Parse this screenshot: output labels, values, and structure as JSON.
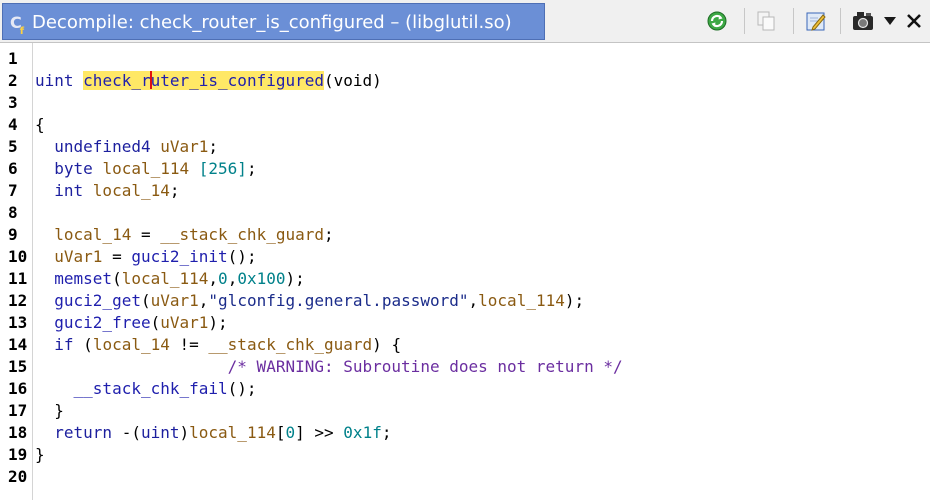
{
  "window": {
    "title": "Decompile: check_router_is_configured –  (libglutil.so)",
    "accent": "#6b8fd6"
  },
  "toolbar": {
    "icons": [
      "refresh-icon",
      "copy-icon",
      "edit-icon",
      "snapshot-icon",
      "menu-down-icon",
      "close-icon"
    ]
  },
  "code": {
    "line_numbers": [
      "1",
      "2",
      "3",
      "4",
      "5",
      "6",
      "7",
      "8",
      "9",
      "10",
      "11",
      "12",
      "13",
      "14",
      "15",
      "16",
      "17",
      "18",
      "19",
      "20"
    ],
    "func_name_a": "check_r",
    "func_name_b": "uter_is_configured",
    "lines": {
      "l2_type": "uint ",
      "l2_rest": "(void)",
      "l4": "{",
      "l5_type": "undefined4 ",
      "l5_var": "uVar1",
      "l5_end": ";",
      "l6_type": "byte ",
      "l6_var": "local_114 ",
      "l6_num": "[256]",
      "l6_end": ";",
      "l7_type": "int ",
      "l7_var": "local_14",
      "l7_end": ";",
      "l9_var": "local_14",
      "l9_op": " = ",
      "l9_fn": "__stack_chk_guard",
      "l9_end": ";",
      "l10_var": "uVar1",
      "l10_op": " = ",
      "l10_fn": "guci2_init",
      "l10_end": "();",
      "l11_fn": "memset",
      "l11_open": "(",
      "l11_var": "local_114",
      "l11_c1": ",",
      "l11_n1": "0",
      "l11_c2": ",",
      "l11_n2": "0x100",
      "l11_end": ");",
      "l12_fn": "guci2_get",
      "l12_open": "(",
      "l12_var1": "uVar1",
      "l12_c1": ",",
      "l12_str": "\"glconfig.general.password\"",
      "l12_c2": ",",
      "l12_var2": "local_114",
      "l12_end": ");",
      "l13_fn": "guci2_free",
      "l13_open": "(",
      "l13_var": "uVar1",
      "l13_end": ");",
      "l14_kw": "if ",
      "l14_open": "(",
      "l14_var": "local_14",
      "l14_op": " != ",
      "l14_fn": "__stack_chk_guard",
      "l14_end": ") {",
      "l15_cm": "/* WARNING: Subroutine does not return */",
      "l16_fn": "__stack_chk_fail",
      "l16_end": "();",
      "l17": "}",
      "l18_kw": "return ",
      "l18_a": "-(",
      "l18_ty": "uint",
      "l18_b": ")",
      "l18_var": "local_114",
      "l18_c": "[",
      "l18_n": "0",
      "l18_d": "] >> ",
      "l18_n2": "0x1f",
      "l18_end": ";",
      "l19": "}"
    }
  }
}
